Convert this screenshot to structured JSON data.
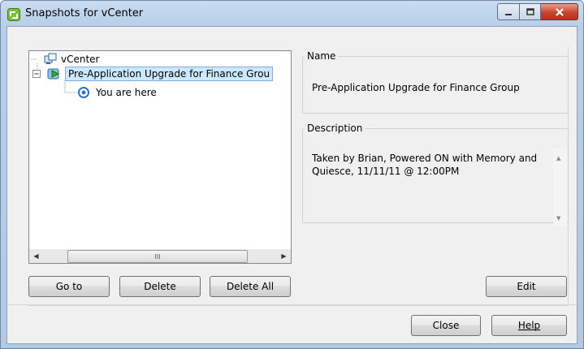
{
  "window": {
    "title": "Snapshots for vCenter"
  },
  "tree": {
    "root_label": "vCenter",
    "snapshot_label": "Pre-Application Upgrade for Finance Grou",
    "current_label": "You are here"
  },
  "scrollbar": {
    "thumb_glyph": "III"
  },
  "left_buttons": {
    "goto": "Go to",
    "delete": "Delete",
    "delete_all": "Delete All"
  },
  "name_group": {
    "legend": "Name",
    "value": "Pre-Application Upgrade for Finance Group"
  },
  "description_group": {
    "legend": "Description",
    "value": "Taken by Brian, Powered ON with Memory and Quiesce, 11/11/11 @ 12:00PM"
  },
  "edit_button": "Edit",
  "footer": {
    "close": "Close",
    "help": "Help"
  },
  "colors": {
    "selection": "#cce8ff",
    "selection_border": "#84acdd",
    "title_bar": "#b9d1ea",
    "close_button": "#c74530"
  }
}
